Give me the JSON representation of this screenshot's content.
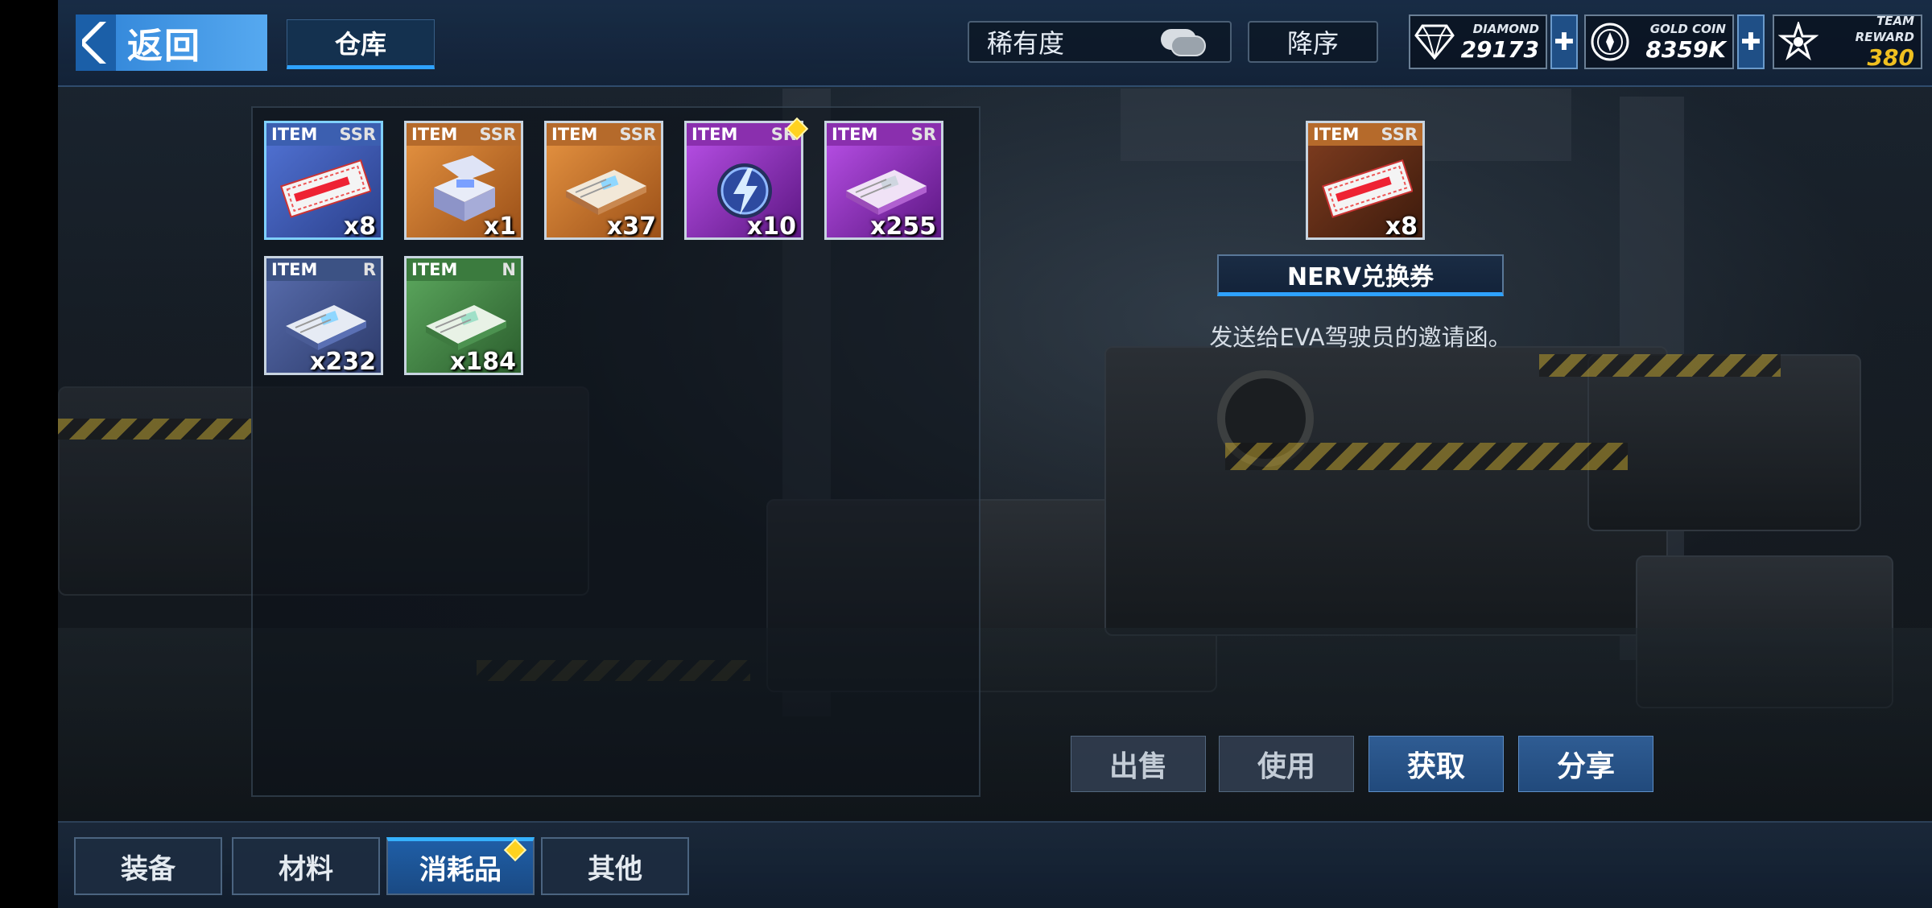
{
  "topbar": {
    "back_label": "返回",
    "warehouse_tab": "仓库",
    "rarity_label": "稀有度",
    "sort_label": "降序"
  },
  "currencies": [
    {
      "caption": "DIAMOND",
      "value": "29173",
      "icon": "diamond-icon"
    },
    {
      "caption": "GOLD COIN",
      "value": "8359K",
      "icon": "gold-coin-icon"
    },
    {
      "caption": "TEAM REWARD",
      "value": "380",
      "icon": "team-reward-icon"
    }
  ],
  "inventory": {
    "items": [
      {
        "type": "ITEM",
        "rarity": "SSR",
        "qty": "x8",
        "bg": "blue",
        "icon": "ticket-icon",
        "selected": true
      },
      {
        "type": "ITEM",
        "rarity": "SSR",
        "qty": "x1",
        "bg": "orange",
        "icon": "box-icon"
      },
      {
        "type": "ITEM",
        "rarity": "SSR",
        "qty": "x37",
        "bg": "orange",
        "icon": "document-icon"
      },
      {
        "type": "ITEM",
        "rarity": "SR",
        "qty": "x10",
        "bg": "purple",
        "icon": "energy-icon",
        "new": true
      },
      {
        "type": "ITEM",
        "rarity": "SR",
        "qty": "x255",
        "bg": "purple",
        "icon": "document-icon"
      },
      {
        "type": "ITEM",
        "rarity": "R",
        "qty": "x232",
        "bg": "navy",
        "icon": "document-icon"
      },
      {
        "type": "ITEM",
        "rarity": "N",
        "qty": "x184",
        "bg": "green",
        "icon": "document-icon"
      }
    ]
  },
  "detail": {
    "type": "ITEM",
    "rarity": "SSR",
    "qty": "x8",
    "name": "NERV兑换券",
    "description": "发送给EVA驾驶员的邀请函。",
    "icon": "ticket-icon"
  },
  "actions": {
    "sell": "出售",
    "use": "使用",
    "obtain": "获取",
    "share": "分享"
  },
  "categories": [
    {
      "label": "装备"
    },
    {
      "label": "材料"
    },
    {
      "label": "消耗品",
      "active": true,
      "new": true
    },
    {
      "label": "其他"
    }
  ],
  "colors": {
    "accent": "#2ea2ff",
    "back_button": "#3f95e4",
    "badge": "#ffd21f",
    "team_reward": "#f0c020"
  }
}
